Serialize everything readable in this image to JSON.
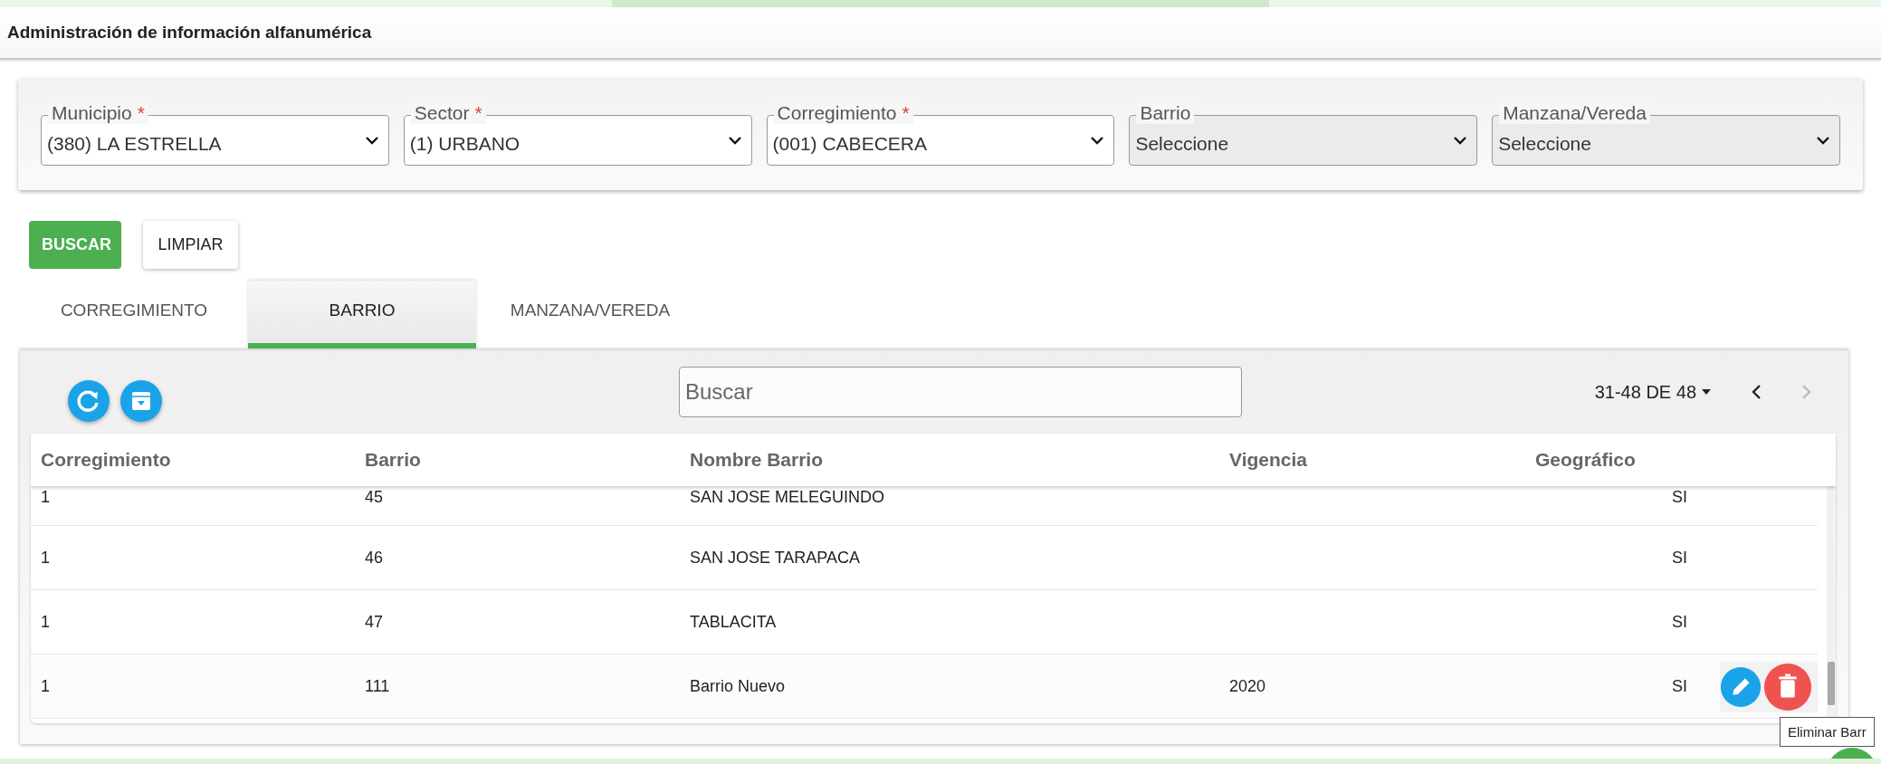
{
  "header": {
    "title": "Administración de información alfanumérica"
  },
  "filters": [
    {
      "label": "Municipio",
      "required": true,
      "value": "(380) LA ESTRELLA",
      "disabled": false
    },
    {
      "label": "Sector",
      "required": true,
      "value": "(1) URBANO",
      "disabled": false
    },
    {
      "label": "Corregimiento",
      "required": true,
      "value": "(001) CABECERA",
      "disabled": false
    },
    {
      "label": "Barrio",
      "required": false,
      "value": "Seleccione",
      "disabled": true
    },
    {
      "label": "Manzana/Vereda",
      "required": false,
      "value": "Seleccione",
      "disabled": true
    }
  ],
  "required_mark": "*",
  "buttons": [
    {
      "label": "BUSCAR",
      "kind": "primary"
    },
    {
      "label": "LIMPIAR",
      "kind": "secondary"
    }
  ],
  "tabs": [
    {
      "label": "CORREGIMIENTO",
      "selected": false
    },
    {
      "label": "BARRIO",
      "selected": true
    },
    {
      "label": "MANZANA/VEREDA",
      "selected": false
    }
  ],
  "table": {
    "search": {
      "placeholder": "Buscar"
    },
    "pagination": {
      "range": "31-48 DE 48",
      "prev_disabled": false,
      "next_disabled": true
    },
    "columns": [
      "Corregimiento",
      "Barrio",
      "Nombre Barrio",
      "Vigencia",
      "Geográfico"
    ],
    "rows": [
      {
        "cells": [
          "1",
          "45",
          "SAN JOSE MELEGUINDO",
          "",
          "SI"
        ],
        "hovered": false
      },
      {
        "cells": [
          "1",
          "46",
          "SAN JOSE TARAPACA",
          "",
          "SI"
        ],
        "hovered": false
      },
      {
        "cells": [
          "1",
          "47",
          "TABLACITA",
          "",
          "SI"
        ],
        "hovered": false
      },
      {
        "cells": [
          "1",
          "111",
          "Barrio Nuevo",
          "2020",
          "SI"
        ],
        "hovered": true
      }
    ],
    "tooltip": "Eliminar Barr"
  }
}
